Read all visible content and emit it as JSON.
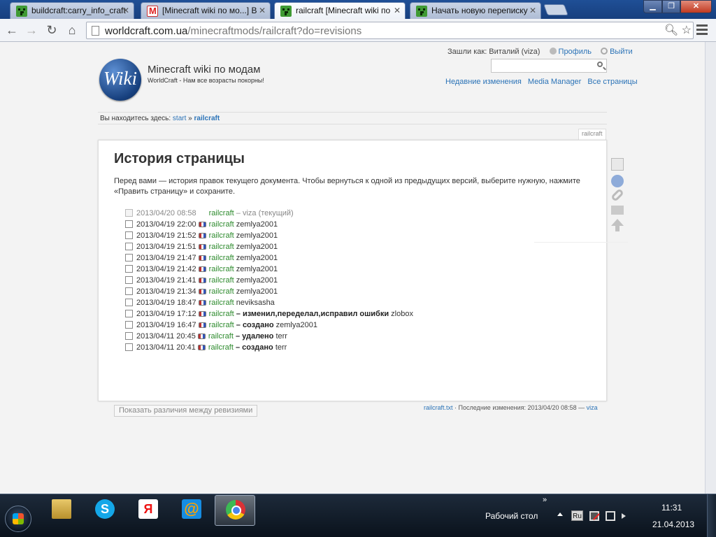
{
  "browser": {
    "tabs": [
      {
        "label": "buildcraft:carry_info_craft",
        "favicon": "creeper-icon",
        "active": false
      },
      {
        "label": "[Minecraft wiki по мо...] В",
        "favicon": "gmail-icon",
        "active": false
      },
      {
        "label": "railcraft [Minecraft wiki по",
        "favicon": "creeper-icon",
        "active": true
      },
      {
        "label": "Начать новую переписку",
        "favicon": "creeper-icon",
        "active": false
      }
    ],
    "tab_close_glyph": "✕",
    "url_host": "worldcraft.com.ua",
    "url_path": "/minecraftmods/railcraft?do=revisions"
  },
  "site": {
    "logo_text": "Wiki",
    "title": "Minecraft wiki по модам",
    "tagline": "WorldCraft - Нам все возрасты покорны!",
    "user": {
      "logged_in_as": "Зашли как: Виталий (viza)",
      "profile": "Профиль",
      "logout": "Выйти"
    },
    "search_placeholder": "",
    "toplinks": [
      "Недавние изменения",
      "Media Manager",
      "Все страницы"
    ],
    "breadcrumb": {
      "prefix": "Вы находитесь здесь:",
      "start": "start",
      "sep": "»",
      "current": "railcraft"
    },
    "page_tag": "railcraft"
  },
  "content": {
    "heading": "История страницы",
    "intro": "Перед вами — история правок текущего документа. Чтобы вернуться к одной из предыдущих версий, выберите нужную, нажмите «Править страницу» и сохраните.",
    "revisions": [
      {
        "date": "2013/04/20 08:58",
        "page": "railcraft",
        "summary": "–",
        "user": "viza",
        "extra": "(текущий)",
        "current": true
      },
      {
        "date": "2013/04/19 22:00",
        "page": "railcraft",
        "summary": "",
        "user": "zemlya2001",
        "extra": "",
        "current": false
      },
      {
        "date": "2013/04/19 21:52",
        "page": "railcraft",
        "summary": "",
        "user": "zemlya2001",
        "extra": "",
        "current": false
      },
      {
        "date": "2013/04/19 21:51",
        "page": "railcraft",
        "summary": "",
        "user": "zemlya2001",
        "extra": "",
        "current": false
      },
      {
        "date": "2013/04/19 21:47",
        "page": "railcraft",
        "summary": "",
        "user": "zemlya2001",
        "extra": "",
        "current": false
      },
      {
        "date": "2013/04/19 21:42",
        "page": "railcraft",
        "summary": "",
        "user": "zemlya2001",
        "extra": "",
        "current": false
      },
      {
        "date": "2013/04/19 21:41",
        "page": "railcraft",
        "summary": "",
        "user": "zemlya2001",
        "extra": "",
        "current": false
      },
      {
        "date": "2013/04/19 21:34",
        "page": "railcraft",
        "summary": "",
        "user": "zemlya2001",
        "extra": "",
        "current": false
      },
      {
        "date": "2013/04/19 18:47",
        "page": "railcraft",
        "summary": "",
        "user": "neviksasha",
        "extra": "",
        "current": false
      },
      {
        "date": "2013/04/19 17:12",
        "page": "railcraft",
        "summary": "– изменил,переделал,исправил ошибки",
        "user": "zlobox",
        "extra": "",
        "current": false
      },
      {
        "date": "2013/04/19 16:47",
        "page": "railcraft",
        "summary": "– создано",
        "user": "zemlya2001",
        "extra": "",
        "current": false
      },
      {
        "date": "2013/04/11 20:45",
        "page": "railcraft",
        "summary": "– удалено",
        "user": "terr",
        "extra": "",
        "current": false
      },
      {
        "date": "2013/04/11 20:41",
        "page": "railcraft",
        "summary": "– создано",
        "user": "terr",
        "extra": "",
        "current": false
      }
    ],
    "show_diff_button": "Показать различия между ревизиями"
  },
  "docinfo": {
    "file": "railcraft.txt",
    "text": "· Последние изменения: 2013/04/20 08:58 —",
    "user": "viza"
  },
  "taskbar": {
    "apps": [
      "folder-icon",
      "skype-icon",
      "yandex-icon",
      "mailru-icon",
      "chrome-icon"
    ],
    "desktop_label": "Рабочий стол",
    "lang": "Ru",
    "time": "11:31",
    "date": "21.04.2013",
    "skype_glyph": "S",
    "yandex_glyph": "Я",
    "mailru_glyph": "@",
    "tray_more_glyph": "»"
  },
  "colors": {
    "link": "#2b73b7",
    "revision_link": "#2c8a2c",
    "titlebar": "#1f4f96"
  }
}
